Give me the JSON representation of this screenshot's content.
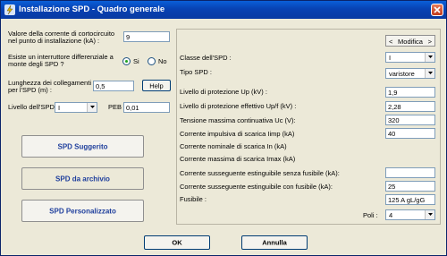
{
  "window": {
    "title": "Installazione SPD - Quadro generale"
  },
  "left": {
    "corrente_label_1": "Valore della corrente di cortocircuito",
    "corrente_label_2": "nel punto di installazione (kA) :",
    "corrente_value": "9",
    "interruttore_label_1": "Esiste un interruttore differenziale a",
    "interruttore_label_2": "monte degli SPD ?",
    "radio_si": "Si",
    "radio_no": "No",
    "lunghezza_label_1": "Lunghezza dei collegamenti",
    "lunghezza_label_2": "per l'SPD (m) :",
    "lunghezza_value": "0,5",
    "help_label": "Help",
    "livello_label": "Livello dell'SPD",
    "livello_value": "I",
    "peb_label": "PEB",
    "peb_value": "0,01",
    "btn_suggerito": "SPD Suggerito",
    "btn_archivio": "SPD da archivio",
    "btn_personalizzato": "SPD Personalizzato"
  },
  "right": {
    "modifica_left": "<",
    "modifica_label": "Modifica",
    "modifica_right": ">",
    "classe_label": "Classe dell'SPD :",
    "classe_value": "I",
    "tipo_label": "Tipo SPD :",
    "tipo_value": "varistore",
    "up_label": "Livello di protezione Up (kV) :",
    "up_value": "1,9",
    "upf_label": "Livello di protezione effettivo Up/f (kV) :",
    "upf_value": "2,28",
    "uc_label": "Tensione massima continuativa Uc (V):",
    "uc_value": "320",
    "iimp_label": "Corrente impulsiva di scarica  Iimp (kA)",
    "iimp_value": "40",
    "in_label": "Corrente nominale di scarica In (kA)",
    "imax_label": "Corrente massima di scarica Imax (kA)",
    "senza_label": "Corrente susseguente estinguibile senza fusibile (kA):",
    "senza_value": "",
    "con_label": "Corrente susseguente estinguibile con fusibile (kA):",
    "con_value": "25",
    "fusibile_label": "Fusibile :",
    "fusibile_value": "125 A gL/gG",
    "poli_label": "Poli :",
    "poli_value": "4"
  },
  "footer": {
    "ok_label": "OK",
    "annulla_label": "Annulla"
  }
}
